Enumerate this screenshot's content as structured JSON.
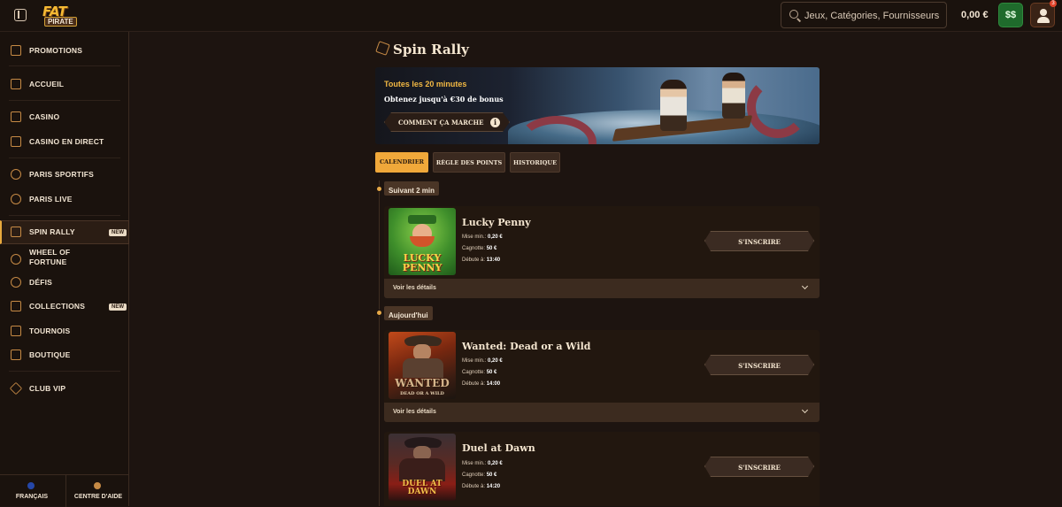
{
  "header": {
    "logo_top": "FAT",
    "logo_bottom": "PIRATE",
    "search_placeholder": "Jeux, Catégories, Fournisseurs",
    "balance": "0,00 €",
    "notification_count": "3"
  },
  "sidebar": {
    "items": [
      {
        "label": "PROMOTIONS",
        "icon": "gift-box-icon"
      },
      {
        "label": "ACCUEIL",
        "icon": "home-icon"
      },
      {
        "label": "CASINO",
        "icon": "slot-machine-icon"
      },
      {
        "label": "CASINO EN DIRECT",
        "icon": "live-cards-icon"
      },
      {
        "label": "PARIS SPORTIFS",
        "icon": "football-icon"
      },
      {
        "label": "PARIS LIVE",
        "icon": "live-football-icon"
      },
      {
        "label": "SPIN RALLY",
        "icon": "flag-icon",
        "badge": "NEW",
        "active": true
      },
      {
        "label": "WHEEL OF FORTUNE",
        "icon": "wheel-icon"
      },
      {
        "label": "DÉFIS",
        "icon": "medal-icon"
      },
      {
        "label": "COLLECTIONS",
        "icon": "cards-icon",
        "badge": "NEW"
      },
      {
        "label": "TOURNOIS",
        "icon": "trophy-icon"
      },
      {
        "label": "BOUTIQUE",
        "icon": "shop-bag-icon"
      },
      {
        "label": "CLUB VIP",
        "icon": "diamond-icon"
      }
    ],
    "footer": {
      "language": "FRANÇAIS",
      "help": "CENTRE D'AIDE"
    }
  },
  "main": {
    "title": "Spin Rally",
    "banner": {
      "line1": "Toutes les 20 minutes",
      "line2": "Obtenez jusqu'à €30 de bonus",
      "button": "COMMENT ÇA MARCHE"
    },
    "tabs": [
      {
        "label": "CALENDRIER",
        "active": true
      },
      {
        "label": "RÈGLE DES POINTS",
        "active": false
      },
      {
        "label": "HISTORIQUE",
        "active": false
      }
    ],
    "sections": [
      {
        "label": "Suivant 2 min"
      },
      {
        "label": "Aujourd'hui"
      }
    ],
    "games": [
      {
        "name": "Lucky Penny",
        "thumb_text": "LUCKY PENNY",
        "min_bet_label": "Mise min.:",
        "min_bet": "0,20 €",
        "pot_label": "Cagnotte:",
        "pot": "50 €",
        "start_label": "Débute à:",
        "start": "13:40",
        "button": "S'INSCRIRE",
        "details": "Voir les détails"
      },
      {
        "name": "Wanted: Dead or a Wild",
        "thumb_text": "WANTED",
        "thumb_subtext": "DEAD OR A WILD",
        "min_bet_label": "Mise min.:",
        "min_bet": "0,20 €",
        "pot_label": "Cagnotte:",
        "pot": "50 €",
        "start_label": "Débute à:",
        "start": "14:00",
        "button": "S'INSCRIRE",
        "details": "Voir les détails"
      },
      {
        "name": "Duel at Dawn",
        "thumb_text": "DUEL AT DAWN",
        "min_bet_label": "Mise min.:",
        "min_bet": "0,20 €",
        "pot_label": "Cagnotte:",
        "pot": "50 €",
        "start_label": "Débute à:",
        "start": "14:20",
        "button": "S'INSCRIRE"
      }
    ]
  },
  "colors": {
    "background": "#1d1410",
    "accent": "#f0a83a",
    "panel": "#22170f",
    "wallet": "#1f6b2c"
  }
}
